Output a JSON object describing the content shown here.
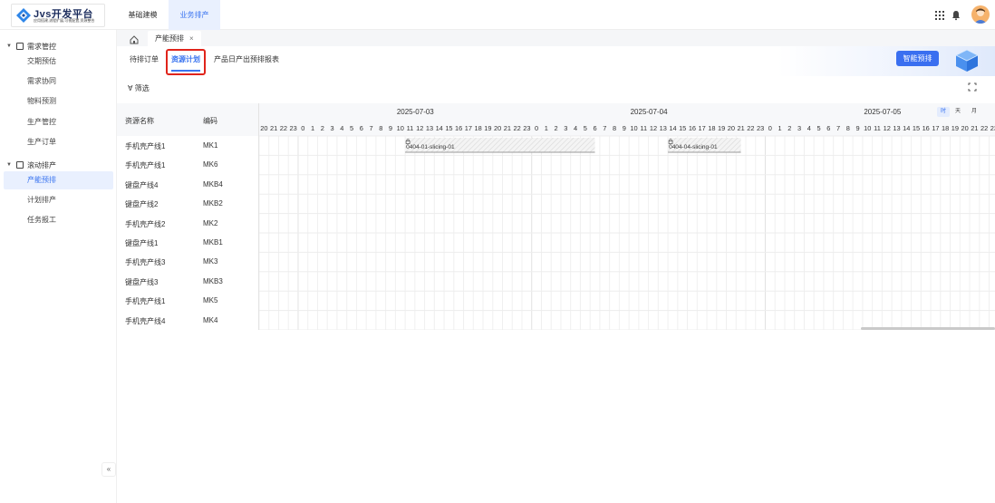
{
  "brand": {
    "title": "Jvs开发平台",
    "subtitle": "应用搭建,流程扩展,可视配置,资源整合"
  },
  "nav": {
    "tabs": [
      {
        "label": "基础建模"
      },
      {
        "label": "业务排产"
      }
    ]
  },
  "sidebar": {
    "groups": [
      {
        "label": "需求管控",
        "items": [
          {
            "label": "交期预估"
          },
          {
            "label": "需求协同"
          },
          {
            "label": "物料预测"
          },
          {
            "label": "生产管控"
          },
          {
            "label": "生产订单"
          }
        ]
      },
      {
        "label": "滚动排产",
        "items": [
          {
            "label": "产能预排"
          },
          {
            "label": "计划排产"
          },
          {
            "label": "任务报工"
          }
        ]
      }
    ],
    "collapse_label": "«"
  },
  "pagetabs": {
    "current": "产能预排",
    "close": "×"
  },
  "subtabs": {
    "items": [
      {
        "label": "待排订单"
      },
      {
        "label": "资源计划"
      },
      {
        "label": "产品日产出预排报表"
      }
    ],
    "smart_button": "智能预排"
  },
  "filter": {
    "label": "筛选",
    "icon": "filter-icon"
  },
  "gantt": {
    "columns": {
      "name": "资源名称",
      "code": "编码"
    },
    "dates": [
      "2025-07-03",
      "2025-07-04",
      "2025-07-05"
    ],
    "start_hour_label": "20",
    "view_modes": [
      {
        "label": "时",
        "active": true
      },
      {
        "label": "天",
        "active": false
      },
      {
        "label": "月",
        "active": false
      }
    ],
    "resources": [
      {
        "name": "手机壳产线1",
        "code": "MK1"
      },
      {
        "name": "手机壳产线1",
        "code": "MK6"
      },
      {
        "name": "键盘产线4",
        "code": "MKB4"
      },
      {
        "name": "键盘产线2",
        "code": "MKB2"
      },
      {
        "name": "手机壳产线2",
        "code": "MK2"
      },
      {
        "name": "键盘产线1",
        "code": "MKB1"
      },
      {
        "name": "手机壳产线3",
        "code": "MK3"
      },
      {
        "name": "键盘产线3",
        "code": "MKB3"
      },
      {
        "name": "手机壳产线1",
        "code": "MK5"
      },
      {
        "name": "手机壳产线4",
        "code": "MK4"
      }
    ],
    "tasks": [
      {
        "row": 0,
        "label": "0404-01-slicing-01",
        "start": "2025-07-03 11:00",
        "end": "2025-07-04 06:30",
        "icon": "lock-icon"
      },
      {
        "row": 0,
        "label": "0404-04-slicing-01",
        "start": "2025-07-04 14:00",
        "end": "2025-07-04 21:30",
        "icon": "lock-icon"
      }
    ]
  },
  "colors": {
    "accent": "#3a74f0",
    "highlight": "#e0241b"
  }
}
